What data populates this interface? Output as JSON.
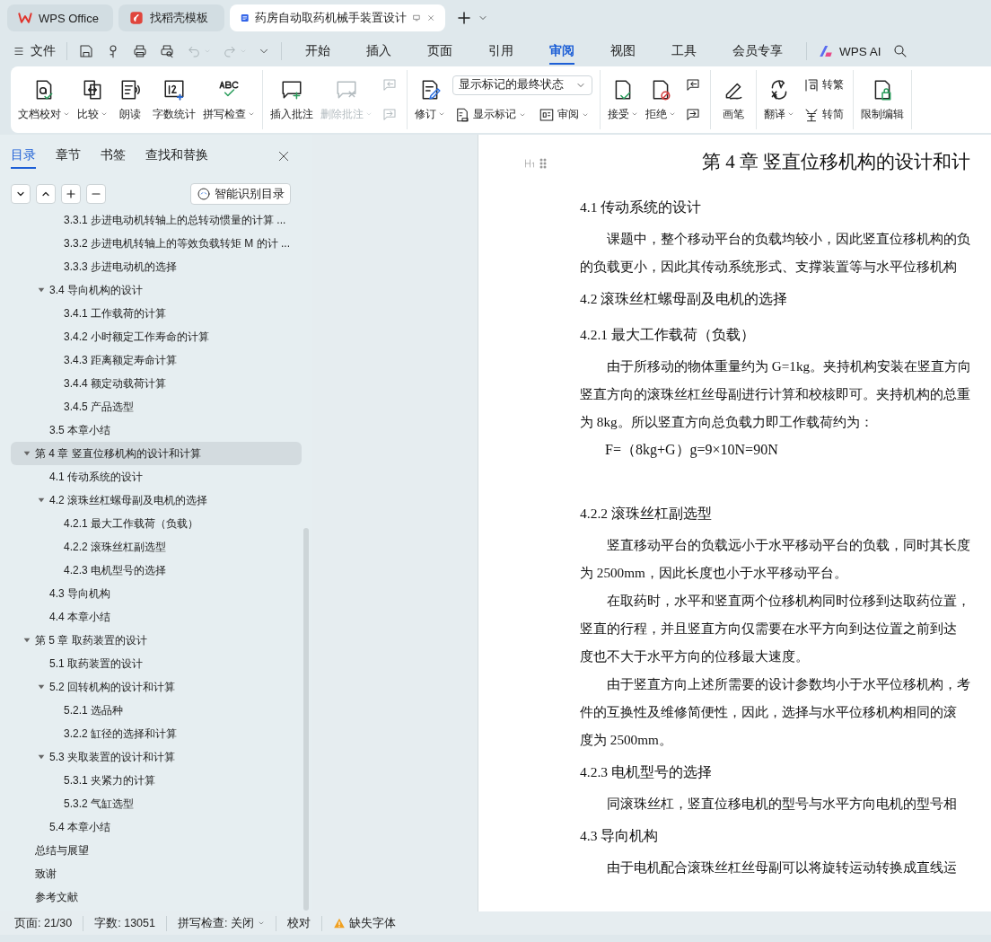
{
  "browser_tabs": [
    {
      "label": "WPS Office",
      "selected": false
    },
    {
      "label": "找稻壳模板",
      "selected": false
    },
    {
      "label": "药房自动取药机械手装置设计",
      "selected": true
    }
  ],
  "menu": {
    "file": "文件",
    "tabs": [
      {
        "label": "开始",
        "selected": false
      },
      {
        "label": "插入",
        "selected": false
      },
      {
        "label": "页面",
        "selected": false
      },
      {
        "label": "引用",
        "selected": false
      },
      {
        "label": "审阅",
        "selected": true
      },
      {
        "label": "视图",
        "selected": false
      },
      {
        "label": "工具",
        "selected": false
      },
      {
        "label": "会员专享",
        "selected": false
      }
    ],
    "ai": "WPS AI"
  },
  "ribbon": {
    "groups": [
      {
        "items": [
          {
            "kind": "large",
            "label": "文档校对",
            "dropdown": true,
            "disabled": false
          },
          {
            "kind": "large",
            "label": "比较",
            "dropdown": true,
            "disabled": false
          },
          {
            "kind": "large",
            "label": "朗读",
            "dropdown": false,
            "disabled": false
          },
          {
            "kind": "large",
            "label": "字数统计",
            "dropdown": false,
            "disabled": false
          },
          {
            "kind": "large",
            "label": "拼写检查",
            "dropdown": true,
            "disabled": false
          }
        ]
      },
      {
        "items": [
          {
            "kind": "large",
            "label": "插入批注",
            "dropdown": false,
            "disabled": false
          },
          {
            "kind": "large",
            "label": "删除批注",
            "dropdown": true,
            "disabled": true
          },
          {
            "kind": "icon-pair",
            "disabled": true
          }
        ]
      },
      {
        "items": [
          {
            "kind": "large",
            "label": "修订",
            "dropdown": true,
            "disabled": false
          },
          {
            "kind": "select-pair",
            "select": "显示标记的最终状态",
            "rows": [
              {
                "label": "显示标记",
                "dropdown": true
              },
              {
                "label": "审阅",
                "dropdown": true
              }
            ]
          }
        ]
      },
      {
        "items": [
          {
            "kind": "large",
            "label": "接受",
            "dropdown": true,
            "disabled": false
          },
          {
            "kind": "large",
            "label": "拒绝",
            "dropdown": true,
            "disabled": false
          },
          {
            "kind": "icon-pair",
            "disabled": false
          }
        ]
      },
      {
        "items": [
          {
            "kind": "large",
            "label": "画笔",
            "dropdown": false,
            "disabled": false
          }
        ]
      },
      {
        "items": [
          {
            "kind": "large",
            "label": "翻译",
            "dropdown": true,
            "disabled": false
          },
          {
            "kind": "small-pair",
            "rows": [
              {
                "label": "转繁",
                "dropdown": false
              },
              {
                "label": "转简",
                "dropdown": false
              }
            ]
          }
        ]
      },
      {
        "items": [
          {
            "kind": "large",
            "label": "限制编辑",
            "dropdown": false,
            "disabled": false
          }
        ]
      }
    ]
  },
  "outline": {
    "tabs": [
      {
        "label": "目录",
        "selected": true
      },
      {
        "label": "章节",
        "selected": false
      },
      {
        "label": "书签",
        "selected": false
      },
      {
        "label": "查找和替换",
        "selected": false
      }
    ],
    "smart_button": "智能识别目录",
    "items": [
      {
        "children": [
          {
            "children": [
              {
                "label": "3.3.1 步进电动机转轴上的总转动惯量的计算 ...",
                "selected": false
              },
              {
                "label": "3.3.2 步进电机转轴上的等效负载转矩 M 的计 ...",
                "selected": false
              },
              {
                "label": "3.3.3 步进电动机的选择",
                "selected": false
              }
            ]
          },
          {
            "label": "3.4 导向机构的设计",
            "selected": false,
            "expanded": true,
            "children": [
              {
                "label": "3.4.1  工作载荷的计算",
                "selected": false
              },
              {
                "label": "3.4.2 小时额定工作寿命的计算",
                "selected": false
              },
              {
                "label": "3.4.3 距离额定寿命计算",
                "selected": false
              },
              {
                "label": "3.4.4 额定动载荷计算",
                "selected": false
              },
              {
                "label": "3.4.5  产品选型",
                "selected": false
              }
            ]
          },
          {
            "label": "3.5 本章小结",
            "selected": false
          }
        ]
      },
      {
        "label": "第 4 章  竖直位移机构的设计和计算",
        "selected": true,
        "expanded": true,
        "children": [
          {
            "label": "4.1 传动系统的设计",
            "selected": false
          },
          {
            "label": "4.2 滚珠丝杠螺母副及电机的选择",
            "selected": false,
            "expanded": true,
            "children": [
              {
                "label": "4.2.1 最大工作载荷（负载）",
                "selected": false
              },
              {
                "label": "4.2.2 滚珠丝杠副选型",
                "selected": false
              },
              {
                "label": "4.2.3 电机型号的选择",
                "selected": false
              }
            ]
          },
          {
            "label": "4.3  导向机构",
            "selected": false
          },
          {
            "label": "4.4  本章小结",
            "selected": false
          }
        ]
      },
      {
        "label": "第 5 章  取药装置的设计",
        "selected": false,
        "expanded": true,
        "children": [
          {
            "label": "5.1 取药装置的设计",
            "selected": false
          },
          {
            "label": "5.2  回转机构的设计和计算",
            "selected": false,
            "expanded": true,
            "children": [
              {
                "label": "5.2.1 选品种",
                "selected": false
              },
              {
                "label": "3.2.2 缸径的选择和计算",
                "selected": false
              }
            ]
          },
          {
            "label": "5.3  夹取装置的设计和计算",
            "selected": false,
            "expanded": true,
            "children": [
              {
                "label": "5.3.1  夹紧力的计算",
                "selected": false
              },
              {
                "label": "5.3.2  气缸选型",
                "selected": false
              }
            ]
          },
          {
            "label": "5.4  本章小结",
            "selected": false
          }
        ]
      },
      {
        "label": "总结与展望",
        "selected": false
      },
      {
        "label": "致谢",
        "selected": false
      },
      {
        "label": "参考文献",
        "selected": false
      }
    ]
  },
  "document": {
    "blocks": [
      {
        "kind": "chapter",
        "text": "第 4 章  竖直位移机构的设计和计"
      },
      {
        "kind": "heading",
        "text": "4.1 传动系统的设计"
      },
      {
        "kind": "para",
        "lines": [
          "课题中，整个移动平台的负载均较小，因此竖直位移机构的负",
          "的负载更小，因此其传动系统形式、支撑装置等与水平位移机构"
        ]
      },
      {
        "kind": "heading",
        "text": "4.2 滚珠丝杠螺母副及电机的选择"
      },
      {
        "kind": "heading",
        "text": "4.2.1 最大工作载荷（负载）"
      },
      {
        "kind": "para",
        "lines": [
          "由于所移动的物体重量约为 G=1kg。夹持机构安装在竖直方向",
          "竖直方向的滚珠丝杠丝母副进行计算和校核即可。夹持机构的总重",
          "为 8kg。所以竖直方向总负载力即工作载荷约为："
        ]
      },
      {
        "kind": "formula",
        "text": "F=（8kg+G）g=9×10N=90N"
      },
      {
        "kind": "heading",
        "text": "4.2.2 滚珠丝杠副选型"
      },
      {
        "kind": "para",
        "lines": [
          "竖直移动平台的负载远小于水平移动平台的负载，同时其长度",
          "为 2500mm，因此长度也小于水平移动平台。"
        ]
      },
      {
        "kind": "para",
        "lines": [
          "在取药时，水平和竖直两个位移机构同时位移到达取药位置，",
          "竖直的行程，并且竖直方向仅需要在水平方向到达位置之前到达",
          "度也不大于水平方向的位移最大速度。"
        ]
      },
      {
        "kind": "para",
        "lines": [
          "由于竖直方向上述所需要的设计参数均小于水平位移机构，考",
          "件的互换性及维修简便性，因此，选择与水平位移机构相同的滚",
          "度为 2500mm。"
        ]
      },
      {
        "kind": "heading",
        "text": "4.2.3 电机型号的选择"
      },
      {
        "kind": "para",
        "lines": [
          "同滚珠丝杠，竖直位移电机的型号与水平方向电机的型号相"
        ]
      },
      {
        "kind": "heading",
        "text": "4.3  导向机构"
      },
      {
        "kind": "para",
        "lines": [
          "由于电机配合滚珠丝杠丝母副可以将旋转运动转换成直线运"
        ]
      }
    ]
  },
  "status_bar": {
    "page": "页面: 21/30",
    "words": "字数: 13051",
    "spell": "拼写检查: 关闭",
    "proof": "校对",
    "missing_font": "缺失字体"
  }
}
